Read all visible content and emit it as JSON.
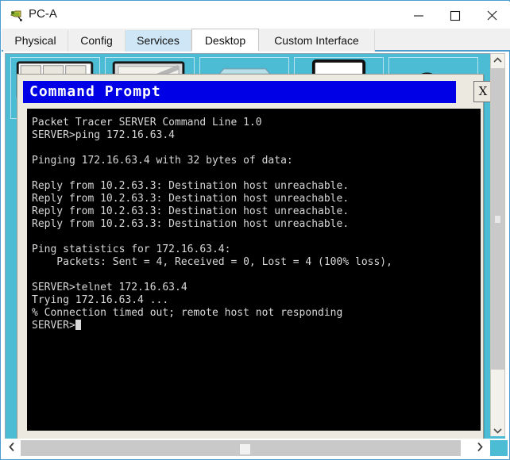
{
  "window": {
    "title": "PC-A",
    "icon": "packet-tracer-device-icon",
    "controls": {
      "minimize": "—",
      "maximize": "□",
      "close": "✕"
    }
  },
  "tabs": [
    {
      "label": "Physical",
      "state": "normal"
    },
    {
      "label": "Config",
      "state": "normal"
    },
    {
      "label": "Services",
      "state": "hover"
    },
    {
      "label": "Desktop",
      "state": "active"
    },
    {
      "label": "Custom Interface",
      "state": "normal"
    }
  ],
  "desktop": {
    "background_color": "#4bbcd4",
    "icons": [
      {
        "name": "ip-configuration-icon"
      },
      {
        "name": "dial-up-icon"
      },
      {
        "name": "terminal-icon"
      },
      {
        "name": "command-prompt-icon"
      },
      {
        "name": "web-browser-icon"
      }
    ]
  },
  "command_prompt": {
    "title": "Command Prompt",
    "title_bar_color": "#0000e6",
    "close_label": "X",
    "screen_bg": "#000000",
    "text_color": "#d8d8d8",
    "lines": [
      "Packet Tracer SERVER Command Line 1.0",
      "SERVER>ping 172.16.63.4",
      "",
      "Pinging 172.16.63.4 with 32 bytes of data:",
      "",
      "Reply from 10.2.63.3: Destination host unreachable.",
      "Reply from 10.2.63.3: Destination host unreachable.",
      "Reply from 10.2.63.3: Destination host unreachable.",
      "Reply from 10.2.63.3: Destination host unreachable.",
      "",
      "Ping statistics for 172.16.63.4:",
      "    Packets: Sent = 4, Received = 0, Lost = 4 (100% loss),",
      "",
      "SERVER>telnet 172.16.63.4",
      "Trying 172.16.63.4 ...",
      "% Connection timed out; remote host not responding",
      "SERVER>"
    ],
    "cursor_visible": true
  },
  "scrollbars": {
    "vertical": {
      "up_icon": "chevron-up-icon",
      "down_icon": "chevron-down-icon"
    },
    "horizontal": {
      "left_icon": "chevron-left-icon",
      "right_icon": "chevron-right-icon"
    }
  }
}
